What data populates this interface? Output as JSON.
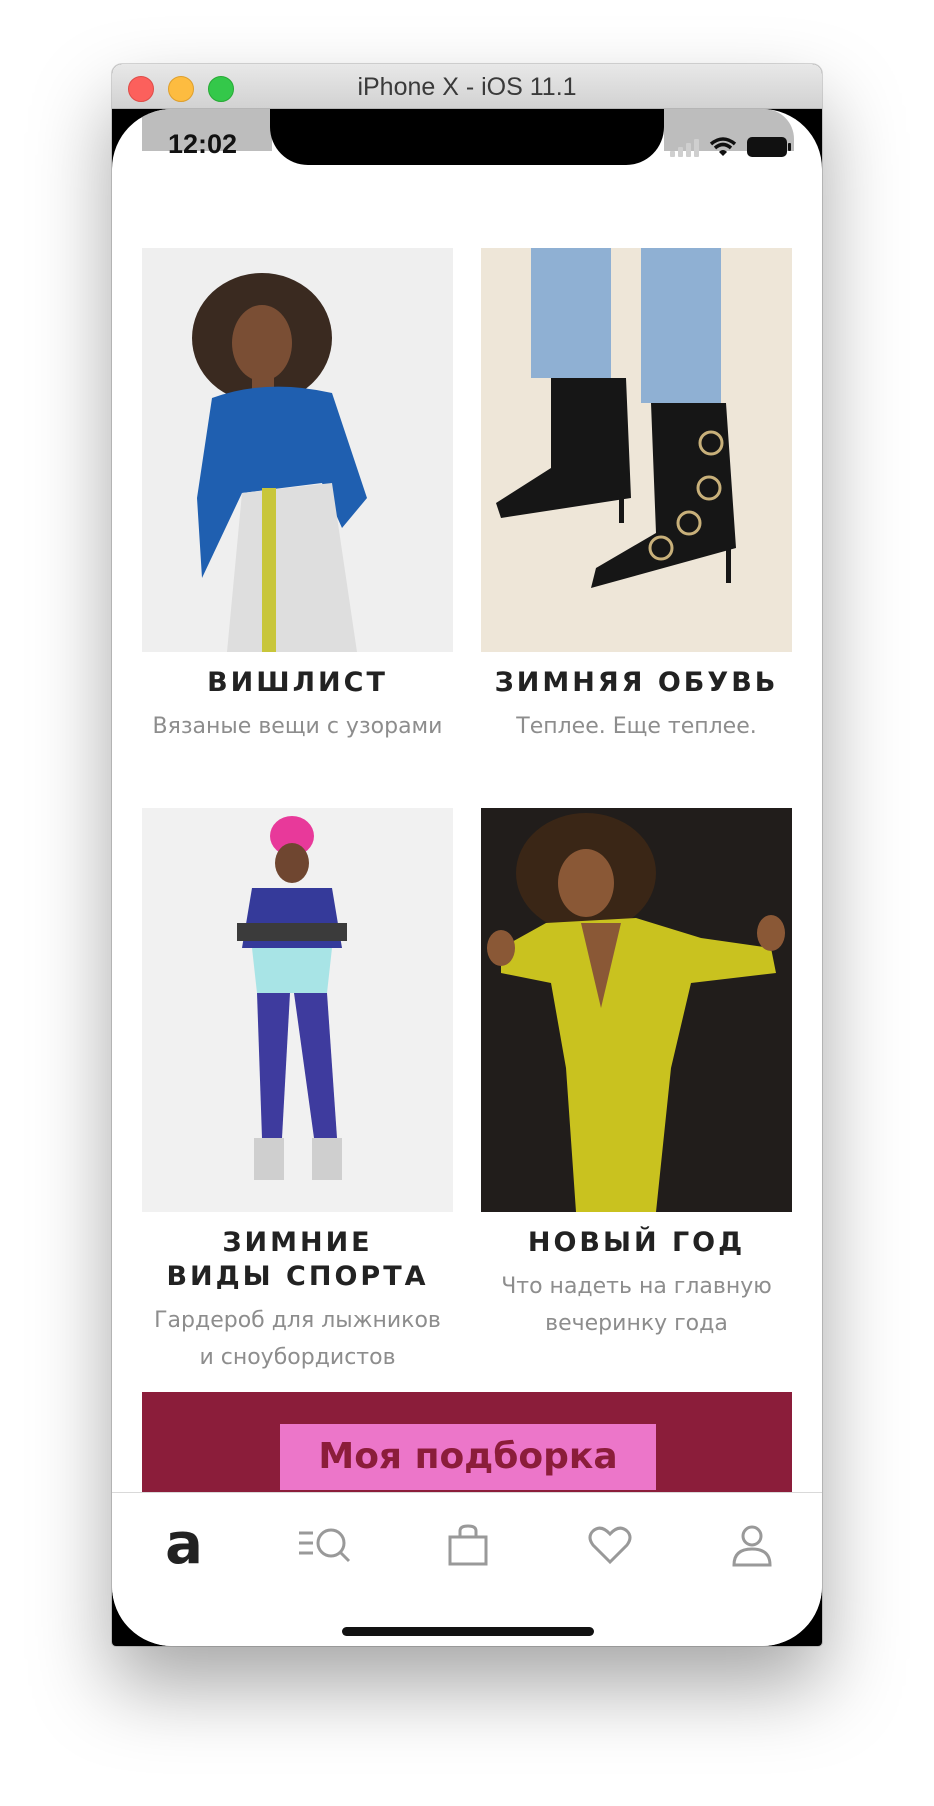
{
  "window": {
    "title": "iPhone X - iOS 11.1"
  },
  "status_bar": {
    "time": "12:02"
  },
  "cards": [
    {
      "title": "ВИШЛИСТ",
      "subtitle": "Вязаные вещи с узорами"
    },
    {
      "title": "ЗИМНЯЯ ОБУВЬ",
      "subtitle": "Теплее. Еще теплее."
    },
    {
      "title_line1": "ЗИМНИЕ",
      "title_line2": "ВИДЫ СПОРТА",
      "subtitle_line1": "Гардероб для лыжников",
      "subtitle_line2": "и сноубордистов"
    },
    {
      "title": "НОВЫЙ ГОД",
      "subtitle_line1": "Что надеть на главную",
      "subtitle_line2": "вечеринку года"
    }
  ],
  "banner": {
    "button_label": "Моя подборка",
    "background": "#8b1d3a",
    "button_color": "#ec76c9"
  },
  "tab_bar": {
    "items": [
      {
        "icon": "home-logo-icon",
        "label": "a"
      },
      {
        "icon": "catalog-search-icon"
      },
      {
        "icon": "bag-icon"
      },
      {
        "icon": "heart-icon"
      },
      {
        "icon": "profile-icon"
      }
    ]
  }
}
